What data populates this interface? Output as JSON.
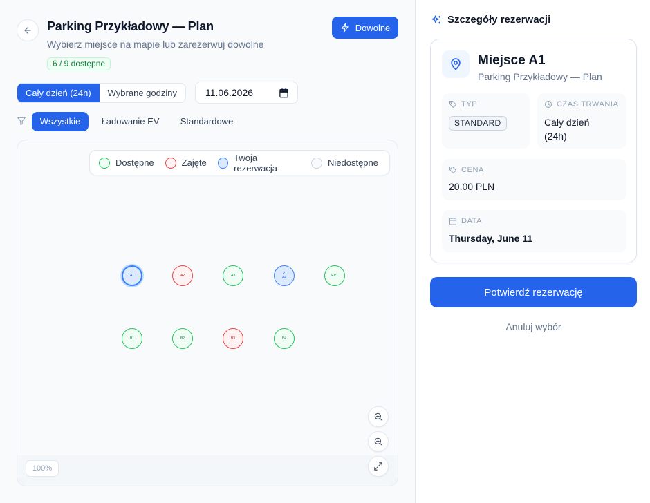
{
  "header": {
    "title": "Parking Przykładowy — Plan",
    "subtitle": "Wybierz miejsce na mapie lub zarezerwuj dowolne",
    "availability": "6 / 9 dostępne",
    "any_button_label": "Dowolne"
  },
  "mode_toggle": {
    "full_day": "Cały dzień (24h)",
    "selected_hours": "Wybrane godziny",
    "active": "full_day"
  },
  "date_input": {
    "value": "11.06.2026"
  },
  "filters": {
    "active": "all",
    "items": [
      {
        "key": "all",
        "label": "Wszystkie"
      },
      {
        "key": "ev",
        "label": "Ładowanie EV"
      },
      {
        "key": "standard",
        "label": "Standardowe"
      }
    ]
  },
  "legend": [
    {
      "key": "available",
      "label": "Dostępne",
      "color": "#22c55e"
    },
    {
      "key": "occupied",
      "label": "Zajęte",
      "color": "#ef4444"
    },
    {
      "key": "mine",
      "label": "Twoja rezerwacja",
      "color": "#3b82f6"
    },
    {
      "key": "unavailable",
      "label": "Niedostępne",
      "color": "#cbd5e1"
    }
  ],
  "spots": [
    {
      "label": "A1",
      "status": "selected"
    },
    {
      "label": "A2",
      "status": "occupied"
    },
    {
      "label": "A3",
      "status": "available"
    },
    {
      "label": "A4",
      "status": "mine"
    },
    {
      "label": "EV1",
      "status": "available"
    },
    {
      "label": "B1",
      "status": "available"
    },
    {
      "label": "B2",
      "status": "available"
    },
    {
      "label": "B3",
      "status": "occupied"
    },
    {
      "label": "B4",
      "status": "available"
    }
  ],
  "map": {
    "zoom": "100%"
  },
  "details": {
    "title": "Szczegóły rezerwacji",
    "spot_name": "Miejsce A1",
    "parking_name": "Parking Przykładowy — Plan",
    "type_label": "TYP",
    "type_value": "STANDARD",
    "duration_label": "CZAS TRWANIA",
    "duration_value_line1": "Cały dzień",
    "duration_value_line2": "(24h)",
    "price_label": "CENA",
    "price_value": "20.00 PLN",
    "date_label": "DATA",
    "date_value": "Thursday, June 11",
    "confirm_label": "Potwierdź rezerwację",
    "cancel_label": "Anuluj wybór"
  },
  "colors": {
    "accent": "#2563eb",
    "available_fill": "#f0fdf4",
    "occupied_fill": "#fef2f2",
    "mine_fill": "#dbeafe"
  }
}
